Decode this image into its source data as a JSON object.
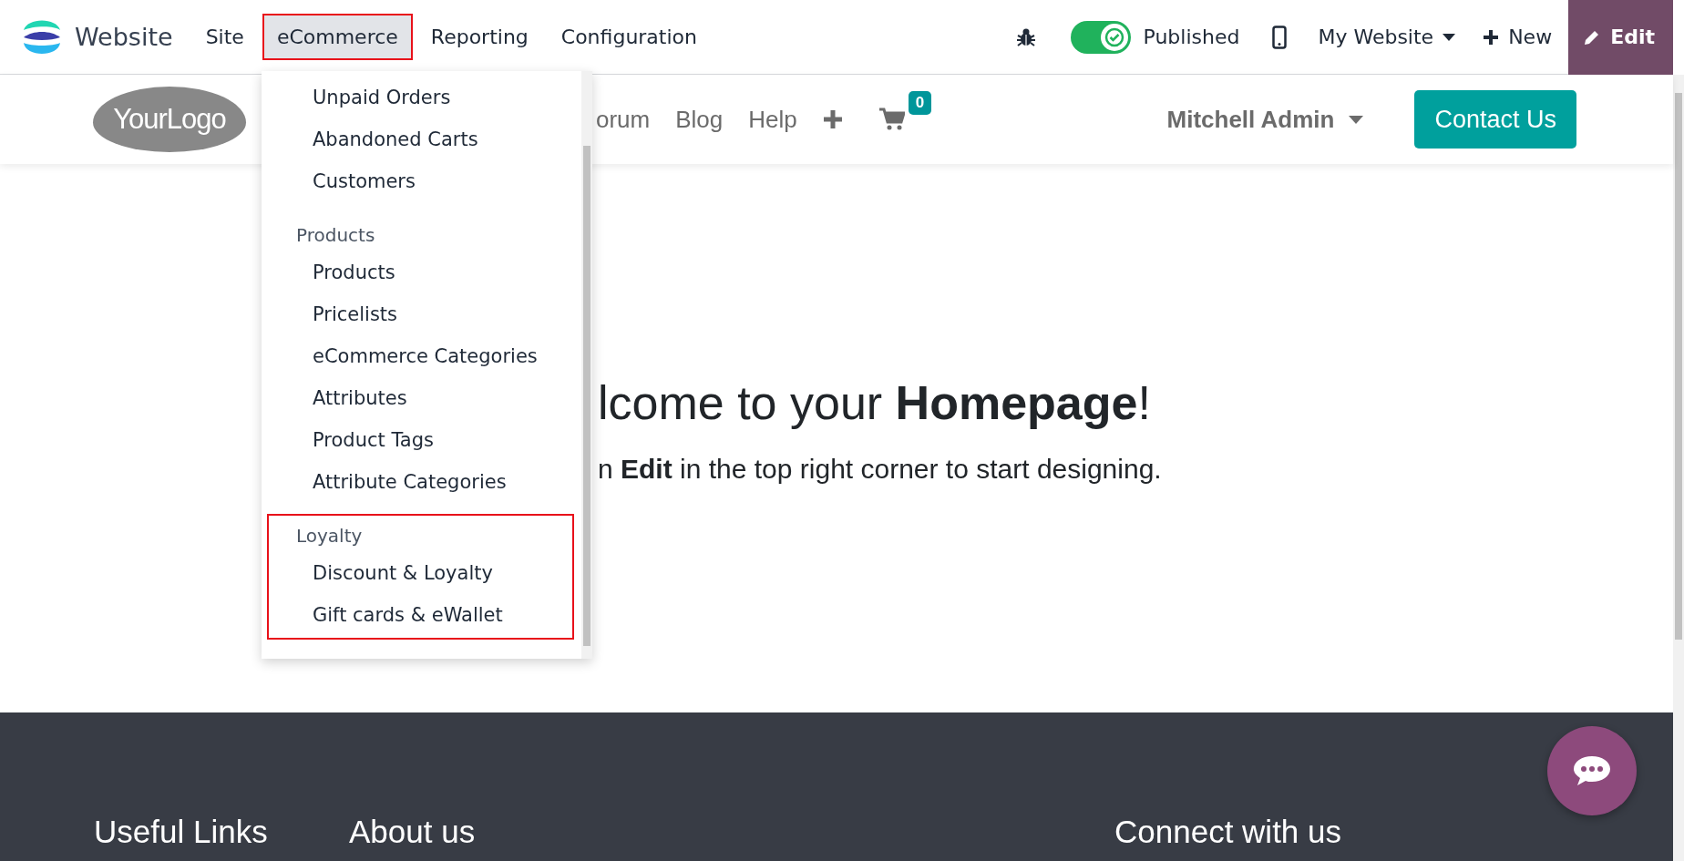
{
  "top_bar": {
    "app_name": "Website",
    "menus": [
      {
        "label": "Site",
        "selected": false,
        "highlighted": false
      },
      {
        "label": "eCommerce",
        "selected": true,
        "highlighted": true
      },
      {
        "label": "Reporting",
        "selected": false,
        "highlighted": false
      },
      {
        "label": "Configuration",
        "selected": false,
        "highlighted": false
      }
    ],
    "published": {
      "label": "Published",
      "on": true
    },
    "website_switcher": "My Website",
    "new_button": "New",
    "edit_button": "Edit"
  },
  "site_header": {
    "logo": "**Your**Logo",
    "nav": [
      "orum",
      "Blog",
      "Help"
    ],
    "cart_count": "0",
    "user": "Mitchell Admin",
    "contact_button": "Contact Us"
  },
  "dropdown": {
    "sections": [
      {
        "highlighted": false,
        "items": [
          "Unpaid Orders",
          "Abandoned Carts",
          "Customers"
        ]
      },
      {
        "heading": "Products",
        "highlighted": false,
        "items": [
          "Products",
          "Pricelists",
          "eCommerce Categories",
          "Attributes",
          "Product Tags",
          "Attribute Categories"
        ]
      },
      {
        "heading": "Loyalty",
        "highlighted": true,
        "items": [
          "Discount & Loyalty",
          "Gift cards & eWallet"
        ]
      }
    ]
  },
  "hero": {
    "title": "lcome to your **Homepage**!",
    "subtitle": "n **Edit** in the top right corner to start designing."
  },
  "footer": {
    "headings": [
      "Useful Links",
      "About us",
      "Connect with us"
    ]
  }
}
